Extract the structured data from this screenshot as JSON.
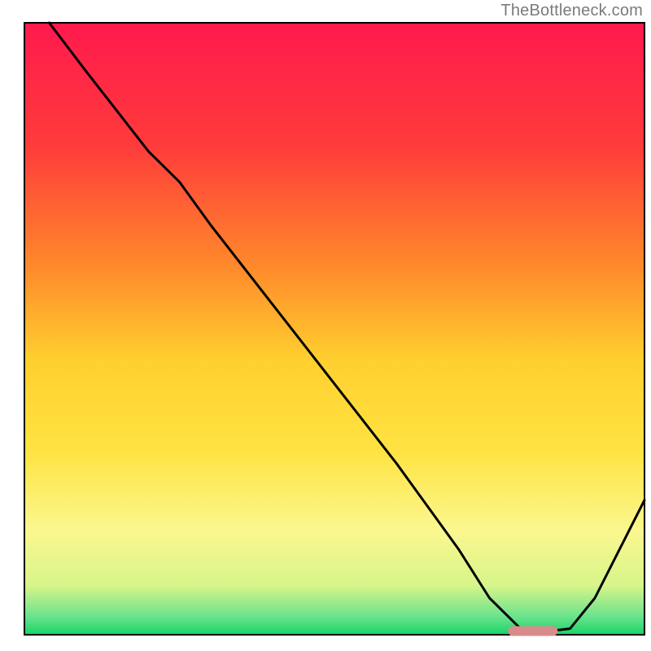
{
  "watermark": "TheBottleneck.com",
  "chart_data": {
    "type": "line",
    "title": "",
    "xlabel": "",
    "ylabel": "",
    "xlim": [
      0,
      100
    ],
    "ylim": [
      0,
      100
    ],
    "gradient_stops": [
      {
        "offset": 0,
        "color": "#ff1a4d"
      },
      {
        "offset": 20,
        "color": "#ff3b3b"
      },
      {
        "offset": 40,
        "color": "#ff8a2b"
      },
      {
        "offset": 55,
        "color": "#ffcf2e"
      },
      {
        "offset": 70,
        "color": "#ffe342"
      },
      {
        "offset": 83,
        "color": "#fbf78f"
      },
      {
        "offset": 92,
        "color": "#d6f58a"
      },
      {
        "offset": 97,
        "color": "#6be38d"
      },
      {
        "offset": 100,
        "color": "#17d468"
      }
    ],
    "curve": {
      "description": "Bottleneck curve: high at left, descends to a flat minimum near x≈80, rises again to the right edge",
      "x": [
        4,
        10,
        20,
        25,
        30,
        40,
        50,
        60,
        70,
        75,
        80,
        84,
        88,
        92,
        96,
        100
      ],
      "y": [
        100,
        92,
        79,
        74,
        67,
        54,
        41,
        28,
        14,
        6,
        1,
        0.5,
        1,
        6,
        14,
        22
      ]
    },
    "optimal_marker": {
      "x_start": 78,
      "x_end": 86,
      "y": 0.6,
      "color": "#d98b8b"
    }
  }
}
